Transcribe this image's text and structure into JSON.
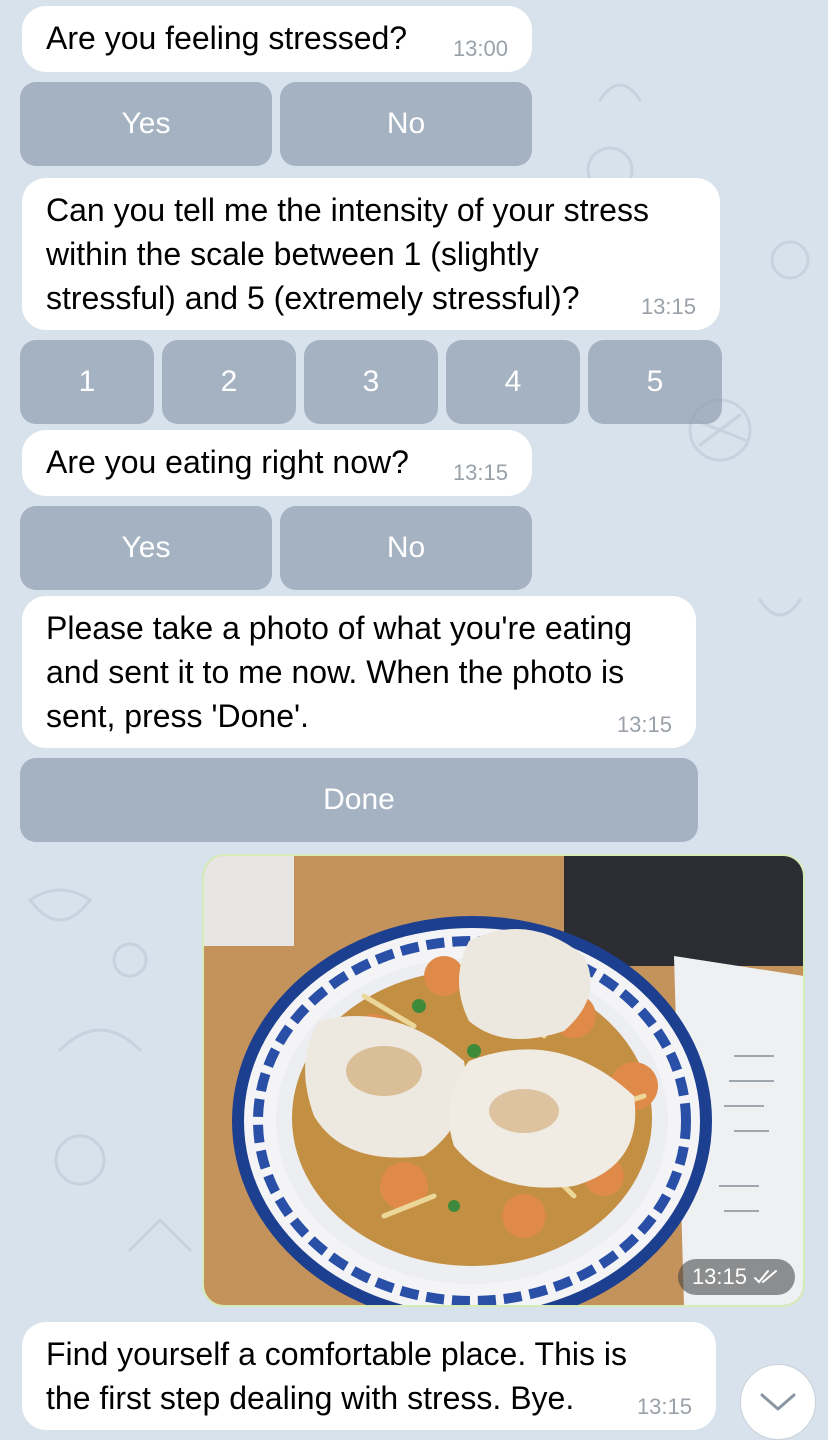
{
  "messages": [
    {
      "text": "Are you feeling stressed?",
      "time": "13:00"
    },
    {
      "text": "Can you tell me the intensity of your stress\nwithin the scale between 1 (slightly\nstressful) and 5 (extremely stressful)?",
      "time": "13:15"
    },
    {
      "text": "Are you eating right now?",
      "time": "13:15"
    },
    {
      "text": "Please take a photo of what you're eating\nand sent it to me now. When the photo is\nsent, press 'Done'.",
      "time": "13:15"
    },
    {
      "text": "Find yourself a comfortable place. This is\nthe first step dealing with stress. Bye.",
      "time": "13:15"
    }
  ],
  "keyboards": {
    "stressed": [
      "Yes",
      "No"
    ],
    "intensity": [
      "1",
      "2",
      "3",
      "4",
      "5"
    ],
    "eating": [
      "Yes",
      "No"
    ],
    "done": [
      "Done"
    ]
  },
  "photo_message": {
    "time": "13:15",
    "status_icon": "double-check-icon",
    "image_icon": "food-bowl-photo"
  },
  "scroll_button": {
    "icon": "chevron-down-icon"
  },
  "colors": {
    "background": "#d8e2ec",
    "incoming_bubble": "#ffffff",
    "outgoing_border": "#d4ecb8",
    "keyboard_button": "#90a0b2",
    "timestamp": "#9aa1a8"
  }
}
